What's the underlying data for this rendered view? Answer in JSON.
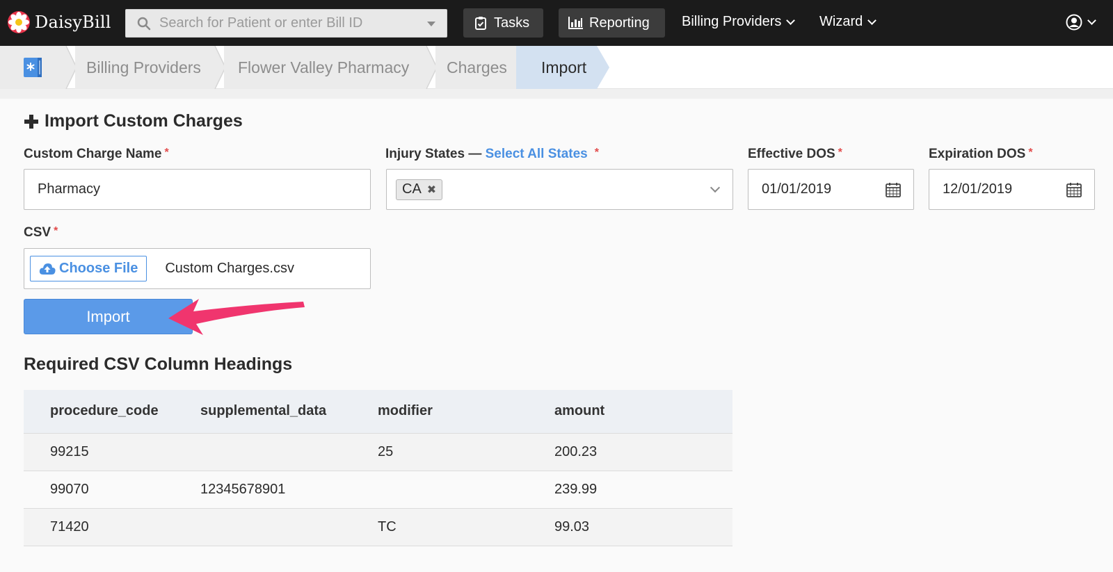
{
  "navbar": {
    "brand": "DaisyBill",
    "search_placeholder": "Search for Patient or enter Bill ID",
    "tasks_label": "Tasks",
    "reporting_label": "Reporting",
    "billing_providers_label": "Billing Providers",
    "wizard_label": "Wizard"
  },
  "breadcrumb": {
    "items": [
      "Billing Providers",
      "Flower Valley Pharmacy",
      "Charges",
      "Import"
    ]
  },
  "form": {
    "title": "Import Custom Charges",
    "custom_charge_name_label": "Custom Charge Name",
    "custom_charge_name_value": "Pharmacy",
    "injury_states_label": "Injury States —",
    "select_all_label": "Select All States",
    "injury_state_tag": "CA",
    "effective_dos_label": "Effective DOS",
    "effective_dos_value": "01/01/2019",
    "expiration_dos_label": "Expiration DOS",
    "expiration_dos_value": "12/01/2019",
    "csv_label": "CSV",
    "choose_file_label": "Choose File",
    "file_name": "Custom Charges.csv",
    "required_mark": "*",
    "import_label": "Import"
  },
  "csv_table": {
    "title": "Required CSV Column Headings",
    "columns": [
      "procedure_code",
      "supplemental_data",
      "modifier",
      "amount"
    ],
    "rows": [
      [
        "99215",
        "",
        "25",
        "200.23"
      ],
      [
        "99070",
        "12345678901",
        "",
        "239.99"
      ],
      [
        "71420",
        "",
        "TC",
        "99.03"
      ]
    ]
  },
  "colors": {
    "navbar_bg": "#1b1b1b",
    "accent": "#4a90e2",
    "import_button": "#5b9ae8",
    "annotation_arrow": "#f0356e"
  }
}
